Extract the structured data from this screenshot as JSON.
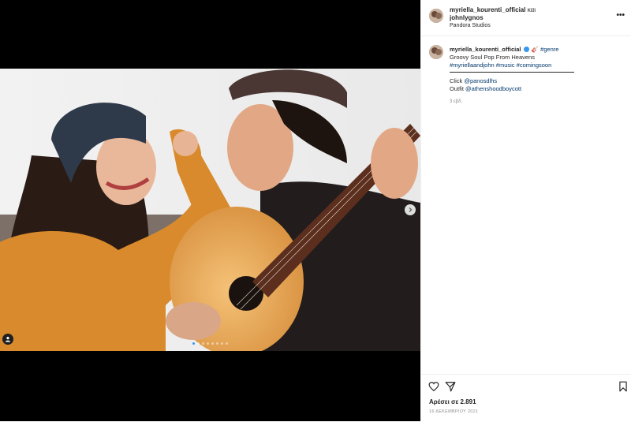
{
  "post": {
    "author": "myriella_kourenti_official",
    "and_word": "και",
    "coauthor": "johnlygnos",
    "location": "Pandora Studios",
    "more_icon": "more-horizontal-icon",
    "more_glyph": "•••"
  },
  "caption": {
    "username": "myriella_kourenti_official",
    "emoji": "🎸",
    "tag_genre": "#genre",
    "line1": "Groovy Soul Pop From Heavens",
    "tag1": "#myriellaandjohn",
    "tag2": "#music",
    "tag3": "#comingsoon",
    "click_label": "Click",
    "click_handle": "@panosdlhs",
    "outfit_label": "Outfit",
    "outfit_handle": "@athenshoodboycott",
    "time_ago": "3 εβδ."
  },
  "footer": {
    "likes": "Αρέσει σε 2.891",
    "date": "16 ΔΕΚΕΜΒΡΙΟΥ 2021"
  },
  "carousel": {
    "slides": 8,
    "active": 1
  },
  "colors": {
    "link": "#00376b",
    "verified": "#3897f0"
  }
}
